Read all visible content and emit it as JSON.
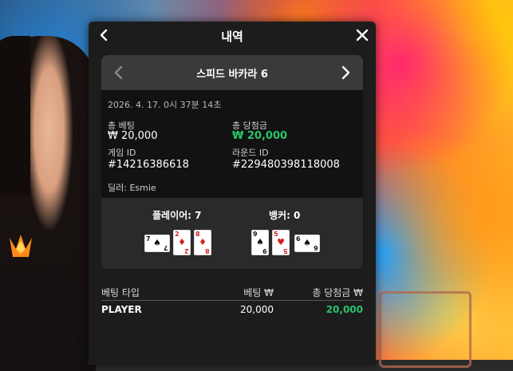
{
  "modal": {
    "title": "내역",
    "back_icon": "chevron-left-icon",
    "close_icon": "close-icon"
  },
  "game": {
    "name": "스피드 바카라 6",
    "datetime": "2026. 4. 17. 0시 37분 14초",
    "total_bet_label": "총 베팅",
    "total_bet_value": "₩ 20,000",
    "total_win_label": "총 당첨금",
    "total_win_value": "₩ 20,000",
    "game_id_label": "게임 ID",
    "game_id_value": "#14216386618",
    "round_id_label": "라운드 ID",
    "round_id_value": "#229480398118008",
    "dealer": "딜러: Esmie"
  },
  "result": {
    "player_label": "플레이어: 7",
    "banker_label": "뱅커: 0",
    "player_cards": [
      {
        "rank": "7",
        "suit": "♠",
        "color": "#111111",
        "orientation": "sideways"
      },
      {
        "rank": "2",
        "suit": "♦",
        "color": "#d32020",
        "orientation": "upright"
      },
      {
        "rank": "8",
        "suit": "♦",
        "color": "#d32020",
        "orientation": "upright"
      }
    ],
    "banker_cards": [
      {
        "rank": "9",
        "suit": "♠",
        "color": "#111111",
        "orientation": "upright"
      },
      {
        "rank": "5",
        "suit": "♥",
        "color": "#d32020",
        "orientation": "upright"
      },
      {
        "rank": "6",
        "suit": "♠",
        "color": "#111111",
        "orientation": "sideways"
      }
    ]
  },
  "bets_table": {
    "headers": [
      "베팅 타입",
      "베팅 ₩",
      "총 당첨금 ₩"
    ],
    "rows": [
      {
        "type": "PLAYER",
        "bet": "20,000",
        "win": "20,000"
      }
    ]
  },
  "colors": {
    "win_green": "#27c46a",
    "modal_bg": "#1c1c1c",
    "card_red": "#d32020"
  }
}
